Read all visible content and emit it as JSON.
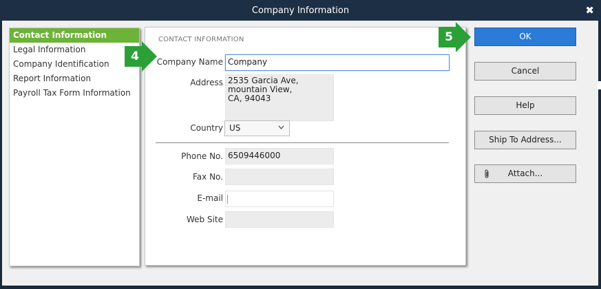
{
  "window": {
    "title": "Company Information",
    "close_label": "✖"
  },
  "sidebar": {
    "items": [
      {
        "label": "Contact Information",
        "active": true
      },
      {
        "label": "Legal Information"
      },
      {
        "label": "Company Identification"
      },
      {
        "label": "Report Information"
      },
      {
        "label": "Payroll Tax Form Information"
      }
    ]
  },
  "panel": {
    "section_title": "CONTACT INFORMATION",
    "company_name": {
      "label": "Company Name",
      "value": "Company"
    },
    "address": {
      "label": "Address",
      "value": "2535 Garcia Ave,\nmountain View,\nCA, 94043"
    },
    "country": {
      "label": "Country",
      "value": "US"
    },
    "phone": {
      "label": "Phone No.",
      "value": "6509446000"
    },
    "fax": {
      "label": "Fax No.",
      "value": ""
    },
    "email": {
      "label": "E-mail",
      "value": ""
    },
    "website": {
      "label": "Web Site",
      "value": ""
    }
  },
  "buttons": {
    "ok": "OK",
    "cancel": "Cancel",
    "help": "Help",
    "ship_to": "Ship To Address...",
    "attach": "Attach..."
  },
  "callouts": {
    "step4": "4",
    "step5": "5"
  },
  "icons": {
    "attach": "paperclip-icon",
    "country_dropdown": "chevron-down-icon",
    "close": "close-icon"
  },
  "colors": {
    "titlebar": "#1d2f45",
    "accent_green": "#6cb338",
    "primary_blue": "#2b7bd8",
    "callout_green": "#2aa037"
  }
}
